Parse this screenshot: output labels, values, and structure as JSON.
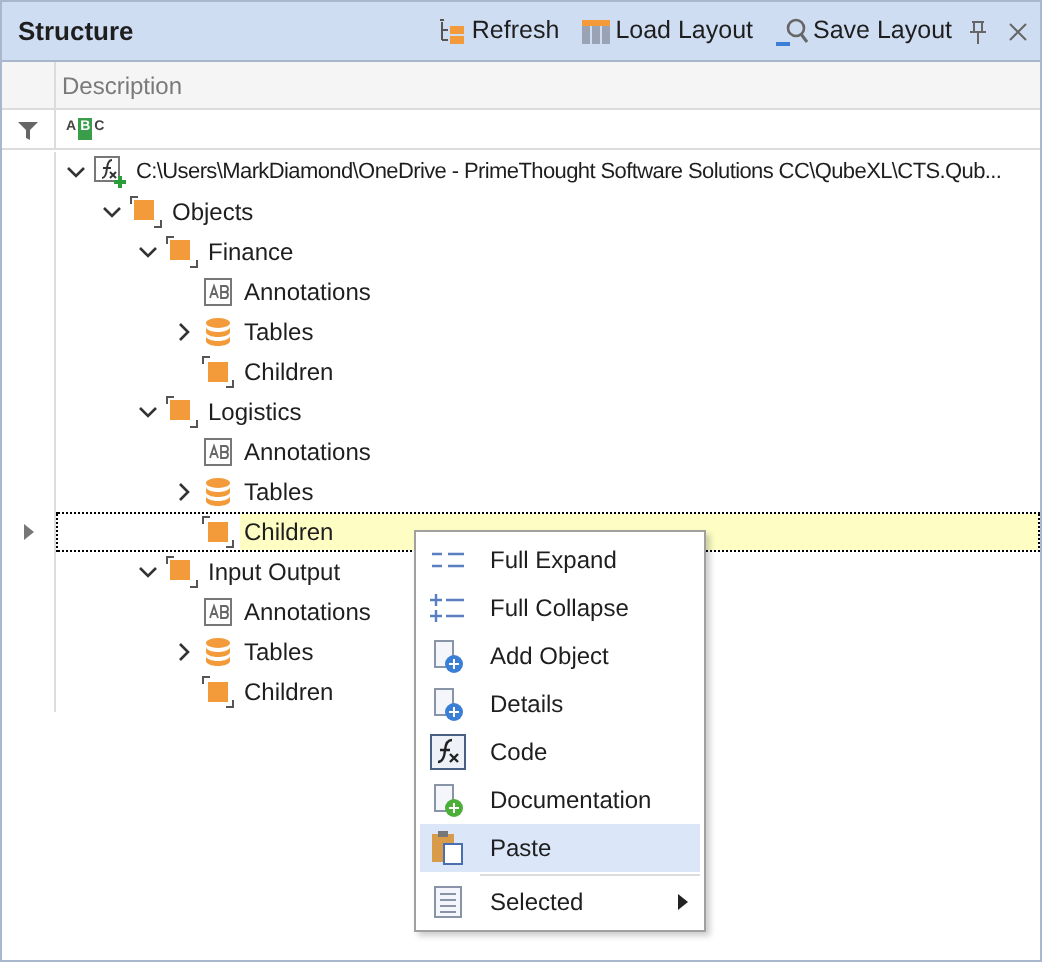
{
  "panel": {
    "title": "Structure",
    "toolbar": [
      {
        "kind": "refresh",
        "label": "Refresh"
      },
      {
        "kind": "load",
        "label": "Load Layout"
      },
      {
        "kind": "save",
        "label": "Save Layout"
      }
    ]
  },
  "grid": {
    "column": "Description",
    "filter_icon_text": "ABC",
    "tree": [
      {
        "kind": "root",
        "label": "C:\\Users\\MarkDiamond\\OneDrive - PrimeThought Software Solutions CC\\QubeXL\\CTS.Qub...",
        "expanded": true,
        "selected": false,
        "children": [
          {
            "kind": "folder",
            "label": "Objects",
            "expanded": true,
            "selected": false,
            "children": [
              {
                "kind": "folder",
                "label": "Finance",
                "expanded": true,
                "selected": false,
                "children": [
                  {
                    "kind": "annotation",
                    "label": "Annotations",
                    "selected": false
                  },
                  {
                    "kind": "table",
                    "label": "Tables",
                    "expanded": false,
                    "selected": false
                  },
                  {
                    "kind": "children",
                    "label": "Children",
                    "selected": false
                  }
                ]
              },
              {
                "kind": "folder",
                "label": "Logistics",
                "expanded": true,
                "selected": false,
                "children": [
                  {
                    "kind": "annotation",
                    "label": "Annotations",
                    "selected": false
                  },
                  {
                    "kind": "table",
                    "label": "Tables",
                    "expanded": false,
                    "selected": false
                  },
                  {
                    "kind": "children",
                    "label": "Children",
                    "selected": true
                  }
                ]
              },
              {
                "kind": "folder",
                "label": "Input Output",
                "expanded": true,
                "selected": false,
                "children": [
                  {
                    "kind": "annotation",
                    "label": "Annotations",
                    "selected": false
                  },
                  {
                    "kind": "table",
                    "label": "Tables",
                    "expanded": false,
                    "selected": false
                  },
                  {
                    "kind": "children",
                    "label": "Children",
                    "selected": false
                  }
                ]
              }
            ]
          }
        ]
      }
    ]
  },
  "context_menu": [
    {
      "kind": "expand",
      "label": "Full Expand",
      "selected": false
    },
    {
      "kind": "collapse",
      "label": "Full Collapse",
      "selected": false
    },
    {
      "kind": "add",
      "label": "Add Object",
      "selected": false
    },
    {
      "kind": "details",
      "label": "Details",
      "selected": false
    },
    {
      "kind": "code",
      "label": "Code",
      "selected": false
    },
    {
      "kind": "doc",
      "label": "Documentation",
      "selected": false
    },
    {
      "kind": "paste",
      "label": "Paste",
      "selected": true
    },
    {
      "kind": "selected",
      "label": "Selected",
      "selected": false,
      "submenu": true,
      "separator_before": true
    }
  ]
}
